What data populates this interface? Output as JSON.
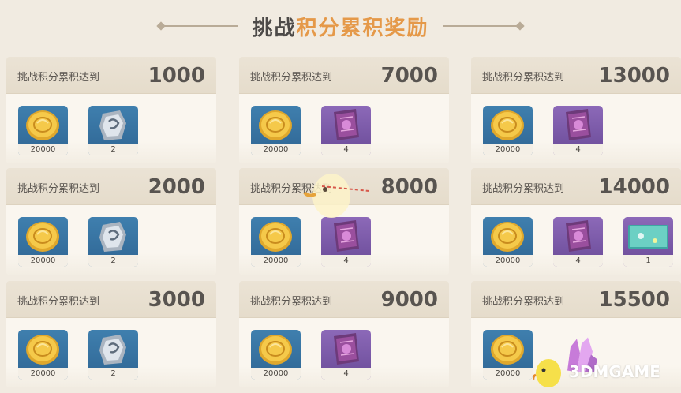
{
  "title": {
    "part1": "挑战",
    "part2": "积分累积奖励"
  },
  "rewards": [
    {
      "label": "挑战积分累积达到",
      "score": "1000",
      "items": [
        {
          "icon": "mora-coin-icon",
          "qty": "20000",
          "bg": "blue"
        },
        {
          "icon": "enhancement-ore-icon",
          "qty": "2",
          "bg": "blue"
        }
      ]
    },
    {
      "label": "挑战积分累积达到",
      "score": "7000",
      "items": [
        {
          "icon": "mora-coin-icon",
          "qty": "20000",
          "bg": "blue"
        },
        {
          "icon": "talent-book-icon",
          "qty": "4",
          "bg": "purple"
        }
      ]
    },
    {
      "label": "挑战积分累积达到",
      "score": "13000",
      "items": [
        {
          "icon": "mora-coin-icon",
          "qty": "20000",
          "bg": "blue"
        },
        {
          "icon": "talent-book-icon",
          "qty": "4",
          "bg": "purple"
        }
      ]
    },
    {
      "label": "挑战积分累积达到",
      "score": "2000",
      "items": [
        {
          "icon": "mora-coin-icon",
          "qty": "20000",
          "bg": "blue"
        },
        {
          "icon": "enhancement-ore-icon",
          "qty": "2",
          "bg": "blue"
        }
      ]
    },
    {
      "label": "挑战积分累积达到",
      "score": "8000",
      "items": [
        {
          "icon": "mora-coin-icon",
          "qty": "20000",
          "bg": "blue"
        },
        {
          "icon": "talent-book-icon",
          "qty": "4",
          "bg": "purple"
        }
      ]
    },
    {
      "label": "挑战积分累积达到",
      "score": "14000",
      "items": [
        {
          "icon": "mora-coin-icon",
          "qty": "20000",
          "bg": "blue"
        },
        {
          "icon": "talent-book-icon",
          "qty": "4",
          "bg": "purple"
        },
        {
          "icon": "namecard-icon",
          "qty": "1",
          "bg": "purple"
        }
      ]
    },
    {
      "label": "挑战积分累积达到",
      "score": "3000",
      "items": [
        {
          "icon": "mora-coin-icon",
          "qty": "20000",
          "bg": "blue"
        },
        {
          "icon": "enhancement-ore-icon",
          "qty": "2",
          "bg": "blue"
        }
      ]
    },
    {
      "label": "挑战积分累积达到",
      "score": "9000",
      "items": [
        {
          "icon": "mora-coin-icon",
          "qty": "20000",
          "bg": "blue"
        },
        {
          "icon": "talent-book-icon",
          "qty": "4",
          "bg": "purple"
        }
      ]
    },
    {
      "label": "挑战积分累积达到",
      "score": "15500",
      "items": [
        {
          "icon": "mora-coin-icon",
          "qty": "20000",
          "bg": "blue"
        },
        {
          "icon": "crystal-icon",
          "qty": "",
          "bg": "none"
        }
      ]
    }
  ],
  "watermark": {
    "text": "3DMGAME",
    "icon": "mascot-logo-icon"
  },
  "colors": {
    "accent": "#e59949",
    "title_dark": "#4d4a48",
    "rarity_blue": "#3f7fae",
    "rarity_purple": "#8c69b8",
    "background": "#f1ebe1"
  }
}
